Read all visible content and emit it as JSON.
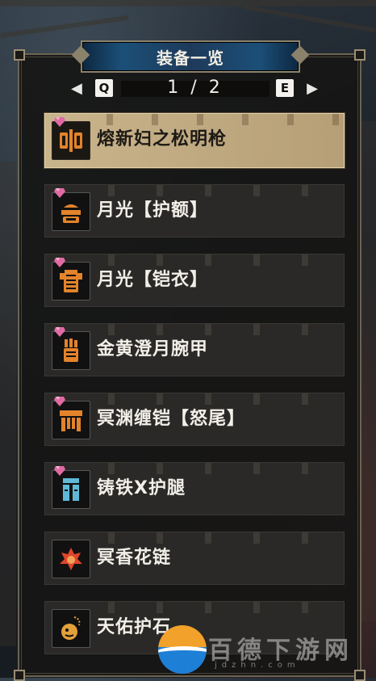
{
  "title": "装备一览",
  "pager": {
    "prev_key": "Q",
    "next_key": "E",
    "prev_arrow": "◀",
    "next_arrow": "▶",
    "page_display": "1 / 2"
  },
  "items": [
    {
      "label": "熔新妇之松明枪",
      "icon": "lance-icon",
      "selected": true,
      "gem": true
    },
    {
      "label": "月光【护额】",
      "icon": "helmet-icon",
      "selected": false,
      "gem": true
    },
    {
      "label": "月光【铠衣】",
      "icon": "chest-armor-icon",
      "selected": false,
      "gem": true
    },
    {
      "label": "金黄澄月腕甲",
      "icon": "arm-guard-icon",
      "selected": false,
      "gem": true
    },
    {
      "label": "冥渊缠铠【怒尾】",
      "icon": "waist-armor-icon",
      "selected": false,
      "gem": true
    },
    {
      "label": "铸铁X护腿",
      "icon": "leg-armor-icon",
      "selected": false,
      "gem": true
    },
    {
      "label": "冥香花链",
      "icon": "charm-icon",
      "selected": false,
      "gem": false
    },
    {
      "label": "天佑护石",
      "icon": "talisman-icon",
      "selected": false,
      "gem": false
    }
  ],
  "colors": {
    "selected_bg": "#c9b48c",
    "row_bg": "#2a2927",
    "icon_orange": "#e3832b",
    "gem_pink": "#e06aa3",
    "title_blue": "#1b4f78"
  },
  "watermark": {
    "text": "百德下游网",
    "sub": "jdzhn.com"
  }
}
